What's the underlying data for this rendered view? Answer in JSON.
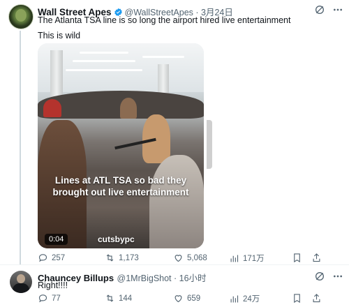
{
  "post": {
    "author_name": "Wall Street Apes",
    "handle_date": "@WallStreetApes · 3月24日",
    "text": "The Atlanta TSA line is so long the airport hired live entertainment",
    "subtext": "This is wild",
    "media": {
      "overlay_text": "Lines at ATL TSA so bad they brought out live entertainment",
      "watermark": "cutsbypc",
      "duration": "0:04"
    },
    "actions": {
      "replies": "257",
      "reposts": "1,173",
      "likes": "5,068",
      "views": "171万"
    }
  },
  "reply": {
    "author_name": "Chauncey Billups",
    "handle_date": "@1MrBigShot · 16小时",
    "text": "Right!!!!",
    "actions": {
      "replies": "77",
      "reposts": "144",
      "likes": "659",
      "views": "24万"
    }
  },
  "colors": {
    "verified": "#1d9bf0",
    "muted": "#536471",
    "text": "#0f1419"
  }
}
